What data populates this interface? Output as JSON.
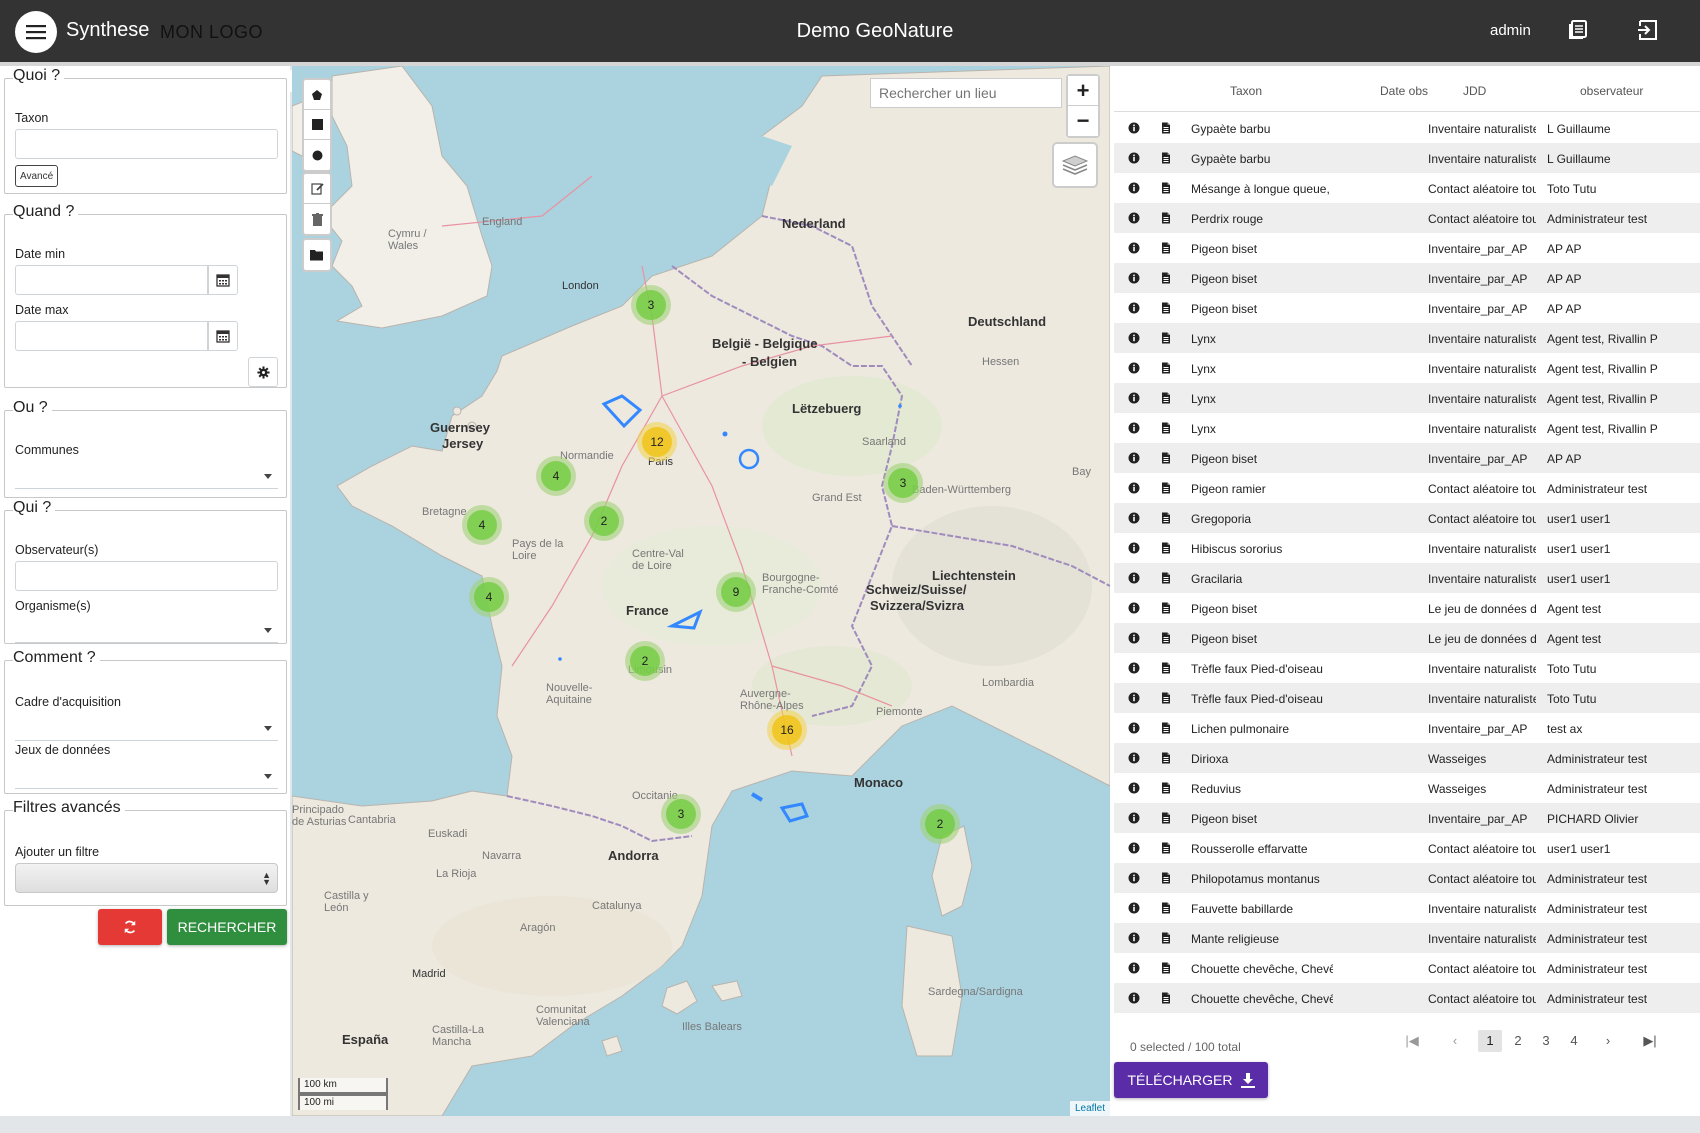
{
  "header": {
    "app_title": "Synthese",
    "logo_text": "MON LOGO",
    "center_title": "Demo GeoNature",
    "user": "admin"
  },
  "sidebar": {
    "quoi": {
      "legend": "Quoi ?",
      "taxon_label": "Taxon",
      "avance_label": "Avancé"
    },
    "quand": {
      "legend": "Quand ?",
      "date_min_label": "Date min",
      "date_max_label": "Date max"
    },
    "ou": {
      "legend": "Ou ?",
      "communes_label": "Communes"
    },
    "qui": {
      "legend": "Qui ?",
      "observateurs_label": "Observateur(s)",
      "organismes_label": "Organisme(s)"
    },
    "comment": {
      "legend": "Comment ?",
      "cadre_label": "Cadre d'acquisition",
      "jdd_label": "Jeux de données"
    },
    "filtres": {
      "legend": "Filtres avancés",
      "ajouter_label": "Ajouter un filtre"
    },
    "search_button": "RECHERCHER"
  },
  "map": {
    "search_placeholder": "Rechercher un lieu",
    "zoom_in": "+",
    "zoom_out": "−",
    "scale_km": "100 km",
    "scale_mi": "100 mi",
    "attribution": "Leaflet",
    "labels": {
      "nederland": "Nederland",
      "belgie": "België - Belgique",
      "belgien": "- Belgien",
      "letzebuerg": "Lëtzebuerg",
      "deutschland": "Deutschland",
      "london": "London",
      "guernsey": "Guernsey",
      "jersey": "Jersey",
      "paris": "Paris",
      "france": "France",
      "liechtenstein": "Liechtenstein",
      "schweiz": "Schweiz/Suisse/",
      "svizzera": "Svizzera/Svizra",
      "monaco": "Monaco",
      "andorra": "Andorra",
      "espana": "España",
      "madrid": "Madrid",
      "england": "England",
      "wales": "Cymru / Wales",
      "bretagne": "Bretagne",
      "normandie": "Normandie",
      "nouvelle_aquitaine": "Nouvelle-Aquitaine",
      "occitanie": "Occitanie",
      "auvergne": "Auvergne-Rhône-Alpes",
      "bourgogne": "Bourgogne-Franche-Comté",
      "grand_est": "Grand Est",
      "pays_loire": "Pays de la Loire",
      "centre": "Centre-Val de Loire",
      "limousin": "Limousin",
      "piemonte": "Piemonte",
      "lombardia": "Lombardia",
      "catalunya": "Catalunya",
      "aragon": "Aragón",
      "sardegna": "Sardegna/Sardigna",
      "illes_balears": "Illes Balears",
      "valenciana": "Comunitat Valenciana",
      "castilla_mancha": "Castilla-La Mancha",
      "castilla_leon": "Castilla y León",
      "euskadi": "Euskadi",
      "la_rioja": "La Rioja",
      "navarra": "Navarra",
      "cantabria": "Cantabria",
      "asturias": "Principado de Asturias",
      "saarland": "Saarland",
      "hessen": "Hessen",
      "bw": "Baden-Württemberg",
      "bayern": "Bay"
    },
    "clusters": [
      {
        "count": "3",
        "kind": "g"
      },
      {
        "count": "12",
        "kind": "y"
      },
      {
        "count": "4",
        "kind": "g"
      },
      {
        "count": "2",
        "kind": "g"
      },
      {
        "count": "4",
        "kind": "g"
      },
      {
        "count": "4",
        "kind": "g"
      },
      {
        "count": "9",
        "kind": "g"
      },
      {
        "count": "2",
        "kind": "g"
      },
      {
        "count": "16",
        "kind": "y"
      },
      {
        "count": "3",
        "kind": "g"
      },
      {
        "count": "3",
        "kind": "g"
      },
      {
        "count": "2",
        "kind": "g"
      }
    ]
  },
  "table": {
    "headers": {
      "taxon": "Taxon",
      "date_obs": "Date obs",
      "jdd": "JDD",
      "observateur": "observateur"
    },
    "rows": [
      {
        "taxon": "Gypaète barbu",
        "jdd": "Inventaire naturaliste",
        "obs": "L Guillaume"
      },
      {
        "taxon": "Gypaète barbu",
        "jdd": "Inventaire naturaliste",
        "obs": "L Guillaume"
      },
      {
        "taxon": "Mésange à longue queue, Orite",
        "jdd": "Contact aléatoire tous",
        "obs": "Toto Tutu"
      },
      {
        "taxon": "Perdrix rouge",
        "jdd": "Contact aléatoire tous",
        "obs": "Administrateur test"
      },
      {
        "taxon": "Pigeon biset",
        "jdd": "Inventaire_par_AP",
        "obs": "AP AP"
      },
      {
        "taxon": "Pigeon biset",
        "jdd": "Inventaire_par_AP",
        "obs": "AP AP"
      },
      {
        "taxon": "Pigeon biset",
        "jdd": "Inventaire_par_AP",
        "obs": "AP AP"
      },
      {
        "taxon": "Lynx",
        "jdd": "Inventaire naturaliste",
        "obs": "Agent test, Rivallin P"
      },
      {
        "taxon": "Lynx",
        "jdd": "Inventaire naturaliste",
        "obs": "Agent test, Rivallin P"
      },
      {
        "taxon": "Lynx",
        "jdd": "Inventaire naturaliste",
        "obs": "Agent test, Rivallin P"
      },
      {
        "taxon": "Lynx",
        "jdd": "Inventaire naturaliste",
        "obs": "Agent test, Rivallin P"
      },
      {
        "taxon": "Pigeon biset",
        "jdd": "Inventaire_par_AP",
        "obs": "AP AP"
      },
      {
        "taxon": "Pigeon ramier",
        "jdd": "Contact aléatoire tous",
        "obs": "Administrateur test"
      },
      {
        "taxon": "Gregoporia",
        "jdd": "Contact aléatoire tous",
        "obs": "user1 user1"
      },
      {
        "taxon": "Hibiscus sororius",
        "jdd": "Inventaire naturaliste",
        "obs": "user1 user1"
      },
      {
        "taxon": "Gracilaria",
        "jdd": "Inventaire naturaliste",
        "obs": "user1 user1"
      },
      {
        "taxon": "Pigeon biset",
        "jdd": "Le jeu de données de",
        "obs": "Agent test"
      },
      {
        "taxon": "Pigeon biset",
        "jdd": "Le jeu de données de",
        "obs": "Agent test"
      },
      {
        "taxon": "Trèfle faux Pied-d'oiseau",
        "jdd": "Inventaire naturaliste",
        "obs": "Toto Tutu"
      },
      {
        "taxon": "Trèfle faux Pied-d'oiseau",
        "jdd": "Inventaire naturaliste",
        "obs": "Toto Tutu"
      },
      {
        "taxon": "Lichen pulmonaire",
        "jdd": "Inventaire_par_AP",
        "obs": "test ax"
      },
      {
        "taxon": "Dirioxa",
        "jdd": "Wasseiges",
        "obs": "Administrateur test"
      },
      {
        "taxon": "Reduvius",
        "jdd": "Wasseiges",
        "obs": "Administrateur test"
      },
      {
        "taxon": "Pigeon biset",
        "jdd": "Inventaire_par_AP",
        "obs": "PICHARD Olivier"
      },
      {
        "taxon": "Rousserolle effarvatte",
        "jdd": "Contact aléatoire tous",
        "obs": "user1 user1"
      },
      {
        "taxon": "Philopotamus montanus",
        "jdd": "Contact aléatoire tous",
        "obs": "Administrateur test"
      },
      {
        "taxon": "Fauvette babillarde",
        "jdd": "Inventaire naturaliste",
        "obs": "Administrateur test"
      },
      {
        "taxon": "Mante religieuse",
        "jdd": "Inventaire naturaliste",
        "obs": "Administrateur test"
      },
      {
        "taxon": "Chouette chevêche, Chevêche",
        "jdd": "Contact aléatoire tous",
        "obs": "Administrateur test"
      },
      {
        "taxon": "Chouette chevêche, Chevêche",
        "jdd": "Contact aléatoire tous",
        "obs": "Administrateur test"
      }
    ],
    "footer": "0 selected / 100 total",
    "pages": [
      "1",
      "2",
      "3",
      "4"
    ],
    "download_label": "TÉLÉCHARGER"
  }
}
